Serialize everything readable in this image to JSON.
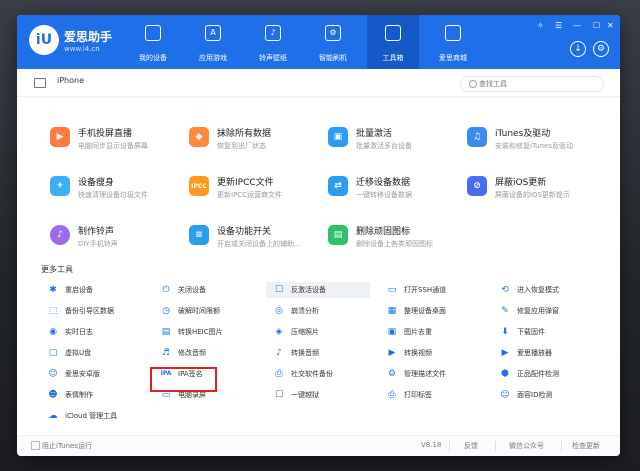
{
  "app": {
    "name": "爱思助手",
    "url": "www.i4.cn",
    "logo": "iU"
  },
  "nav": [
    {
      "label": "我的设备",
      "icon": "apple-icon"
    },
    {
      "label": "应用游戏",
      "icon": "app-icon"
    },
    {
      "label": "铃声壁纸",
      "icon": "music-icon"
    },
    {
      "label": "智能刷机",
      "icon": "flash-icon"
    },
    {
      "label": "工具箱",
      "icon": "toolbox-icon",
      "active": true
    },
    {
      "label": "爱思商城",
      "icon": "store-icon"
    }
  ],
  "device": {
    "name": "iPhone"
  },
  "search": {
    "placeholder": "查找工具"
  },
  "featured": [
    {
      "title": "手机投屏直播",
      "desc": "电脑同步显示设备屏幕",
      "icon": "screen-mirror-icon",
      "color": "#ff7a3d"
    },
    {
      "title": "抹除所有数据",
      "desc": "恢复到出厂状态",
      "icon": "erase-icon",
      "color": "#ff8a3d"
    },
    {
      "title": "批量激活",
      "desc": "批量激活多台设备",
      "icon": "activate-icon",
      "color": "#2b9cf2"
    },
    {
      "title": "iTunes及驱动",
      "desc": "安装和修复iTunes及驱动",
      "icon": "itunes-icon",
      "color": "#3b8bf0"
    },
    {
      "title": "设备瘦身",
      "desc": "快速清理设备垃圾文件",
      "icon": "slim-icon",
      "color": "#3bb0f7"
    },
    {
      "title": "更新IPCC文件",
      "desc": "更新IPCC运营商文件",
      "icon": "ipcc-icon",
      "color": "#ff9a1f"
    },
    {
      "title": "迁移设备数据",
      "desc": "一键转移设备数据",
      "icon": "migrate-icon",
      "color": "#2b9cf2"
    },
    {
      "title": "屏蔽iOS更新",
      "desc": "屏蔽设备的iOS更新提示",
      "icon": "block-update-icon",
      "color": "#4a6cf0"
    },
    {
      "title": "制作铃声",
      "desc": "DIY手机铃声",
      "icon": "ringtone-icon",
      "color": "#9b6cf0"
    },
    {
      "title": "设备功能开关",
      "desc": "开启或关闭设备上的辅助...",
      "icon": "switch-icon",
      "color": "#2b9cf2"
    },
    {
      "title": "删除顽固图标",
      "desc": "删除设备上各类顽固图标",
      "icon": "delete-icon-icon",
      "color": "#2ec06a"
    }
  ],
  "more_title": "更多工具",
  "tools": [
    [
      "重启设备",
      "关闭设备",
      "反激活设备",
      "打开SSH通道",
      "进入恢复模式"
    ],
    [
      "备份引导区数据",
      "破解时间限额",
      "崩溃分析",
      "整理设备桌面",
      "修复应用弹窗"
    ],
    [
      "实时日志",
      "转换HEIC图片",
      "压缩照片",
      "图片去重",
      "下载固件"
    ],
    [
      "虚拟U盘",
      "修改音频",
      "转换音频",
      "转换视频",
      "爱思播放器"
    ],
    [
      "爱思安卓版",
      "IPA签名",
      "社交软件备份",
      "管理描述文件",
      "正品配件检测"
    ],
    [
      "表情制作",
      "电脑录屏",
      "一键越狱",
      "打印标签",
      "面容ID检测"
    ],
    [
      "iCloud 管理工具"
    ]
  ],
  "status": {
    "itunes": "阻止iTunes运行",
    "version": "V8.18",
    "feedback": "反馈",
    "wechat": "微信公众号",
    "update": "检查更新"
  },
  "colors": {
    "brand": "#1f6fe8",
    "highlight": "#e02020"
  }
}
